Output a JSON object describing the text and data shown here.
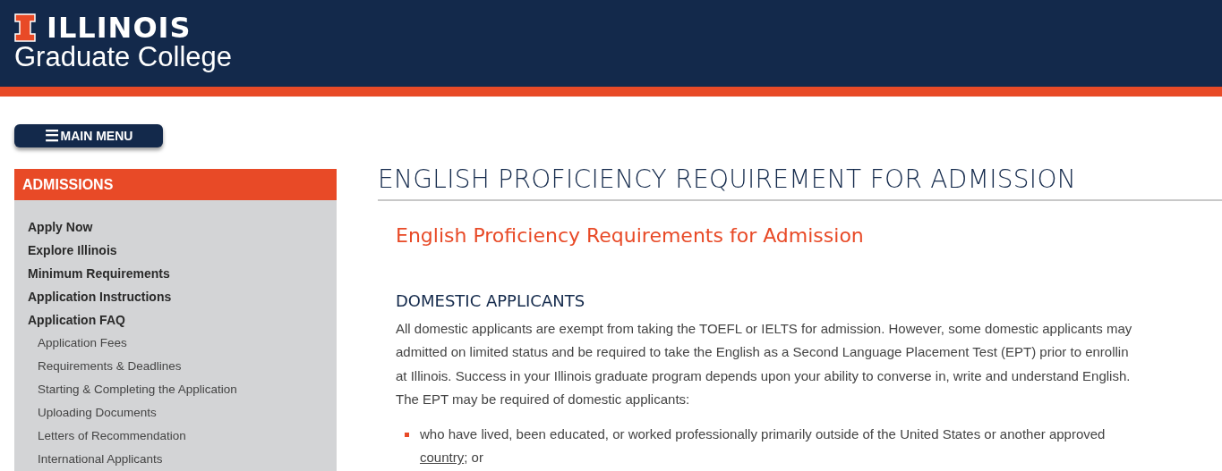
{
  "header": {
    "logo_word": "ILLINOIS",
    "site_title": "Graduate College"
  },
  "main_menu_button": {
    "icon": "☰",
    "label": "MAIN MENU"
  },
  "sidebar": {
    "title": "ADMISSIONS",
    "items": [
      {
        "label": "Apply Now"
      },
      {
        "label": "Explore Illinois"
      },
      {
        "label": "Minimum Requirements"
      },
      {
        "label": "Application Instructions"
      },
      {
        "label": "Application FAQ",
        "children": [
          {
            "label": "Application Fees"
          },
          {
            "label": "Requirements & Deadlines"
          },
          {
            "label": "Starting & Completing the Application"
          },
          {
            "label": "Uploading Documents"
          },
          {
            "label": "Letters of Recommendation"
          },
          {
            "label": "International Applicants"
          }
        ]
      }
    ]
  },
  "page_title": "ENGLISH PROFICIENCY REQUIREMENT FOR ADMISSION",
  "subtitle": "English Proficiency Requirements for Admission",
  "section": {
    "heading": "DOMESTIC APPLICANTS",
    "paragraph_lines": [
      "All domestic applicants are exempt from taking the TOEFL or IELTS for admission. However, some domestic applicants may",
      "admitted on limited status and be required to take the English as a Second Language Placement Test (EPT) prior to enrollin",
      "at Illinois. Success in your Illinois graduate program depends upon your ability to converse in, write and understand English.",
      "The EPT may be required of domestic applicants:"
    ],
    "bullets": [
      {
        "text_before": "who have lived, been educated, or worked professionally primarily outside of the United States or another approved",
        "link": "country",
        "text_after": "; or"
      }
    ]
  }
}
